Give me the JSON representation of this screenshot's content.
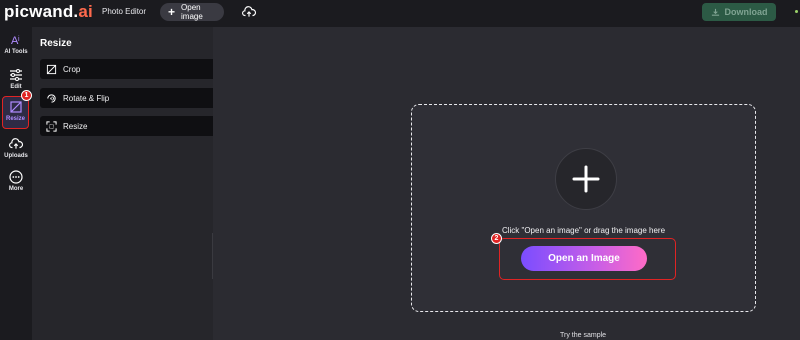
{
  "header": {
    "logo_main": "picwand.",
    "logo_suffix": "ai",
    "photo_editor": "Photo Editor",
    "open_image": "Open image",
    "download": "Download"
  },
  "rail": {
    "items": [
      {
        "label": "AI Tools",
        "icon": "ai-tools-icon"
      },
      {
        "label": "Edit",
        "icon": "sliders-icon"
      },
      {
        "label": "Resize",
        "icon": "resize-icon"
      },
      {
        "label": "Uploads",
        "icon": "upload-cloud-icon"
      },
      {
        "label": "More",
        "icon": "more-icon"
      }
    ],
    "badge_1": "1"
  },
  "panel": {
    "title": "Resize",
    "tools": [
      {
        "label": "Crop",
        "icon": "crop-icon"
      },
      {
        "label": "Rotate & Flip",
        "icon": "rotate-flip-icon"
      },
      {
        "label": "Resize",
        "icon": "resize-frame-icon"
      }
    ]
  },
  "canvas": {
    "hint": "Click \"Open an image\" or drag the image here",
    "open_button": "Open an Image",
    "badge_2": "2",
    "try_sample": "Try the sample"
  },
  "colors": {
    "accent_red": "#e02424",
    "gradient_start": "#7a4dff",
    "gradient_end": "#ff6bc6",
    "download_bg": "#2c5a45"
  }
}
